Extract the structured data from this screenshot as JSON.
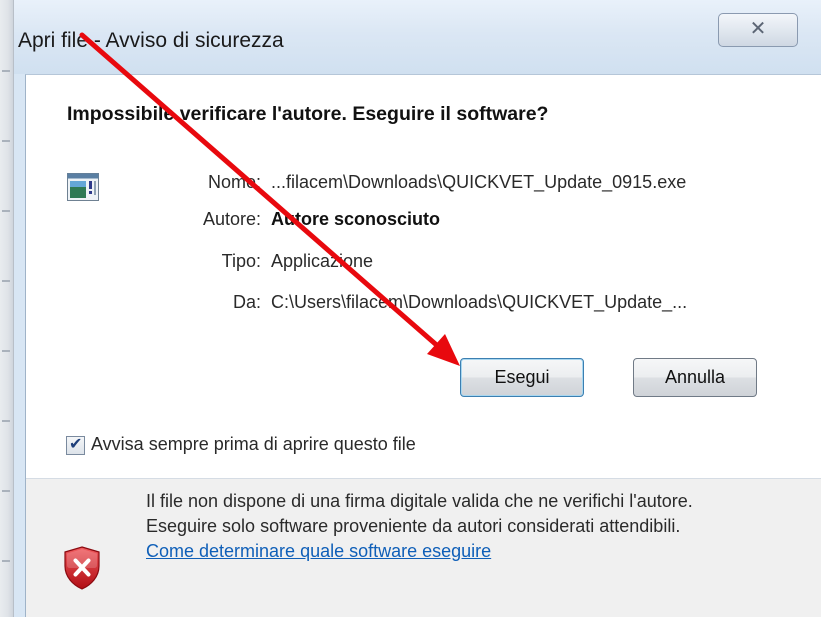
{
  "window": {
    "title": "Apri file - Avviso di sicurezza",
    "close_symbol": "✕"
  },
  "dialog": {
    "heading": "Impossibile verificare l'autore. Eseguire il software?",
    "fields": [
      {
        "label": "Nome:",
        "value": "...filacem\\Downloads\\QUICKVET_Update_0915.exe",
        "bold": false
      },
      {
        "label": "Autore:",
        "value": "Autore sconosciuto",
        "bold": true
      },
      {
        "label": "Tipo:",
        "value": "Applicazione",
        "bold": false
      },
      {
        "label": "Da:",
        "value": "C:\\Users\\filacem\\Downloads\\QUICKVET_Update_...",
        "bold": false
      }
    ],
    "buttons": {
      "run_label": "Esegui",
      "cancel_label": "Annulla"
    },
    "checkbox": {
      "label": "Avvisa sempre prima di aprire questo file",
      "checked": true,
      "check_symbol": "✔"
    }
  },
  "footer": {
    "line1": "Il file non dispone di una firma digitale valida che ne verifichi l'autore.",
    "line2": "Eseguire solo software proveniente da autori considerati attendibili.",
    "link": "Come determinare quale software eseguire"
  },
  "icons": {
    "app": "application-window-icon",
    "warning": "security-shield-x-icon",
    "close": "close-icon",
    "annotation": "red-arrow-annotation"
  },
  "colors": {
    "titlebar": "#dbe7f4",
    "link": "#0f5fb8",
    "arrow": "#e8090e",
    "shield": "#c8141a"
  }
}
